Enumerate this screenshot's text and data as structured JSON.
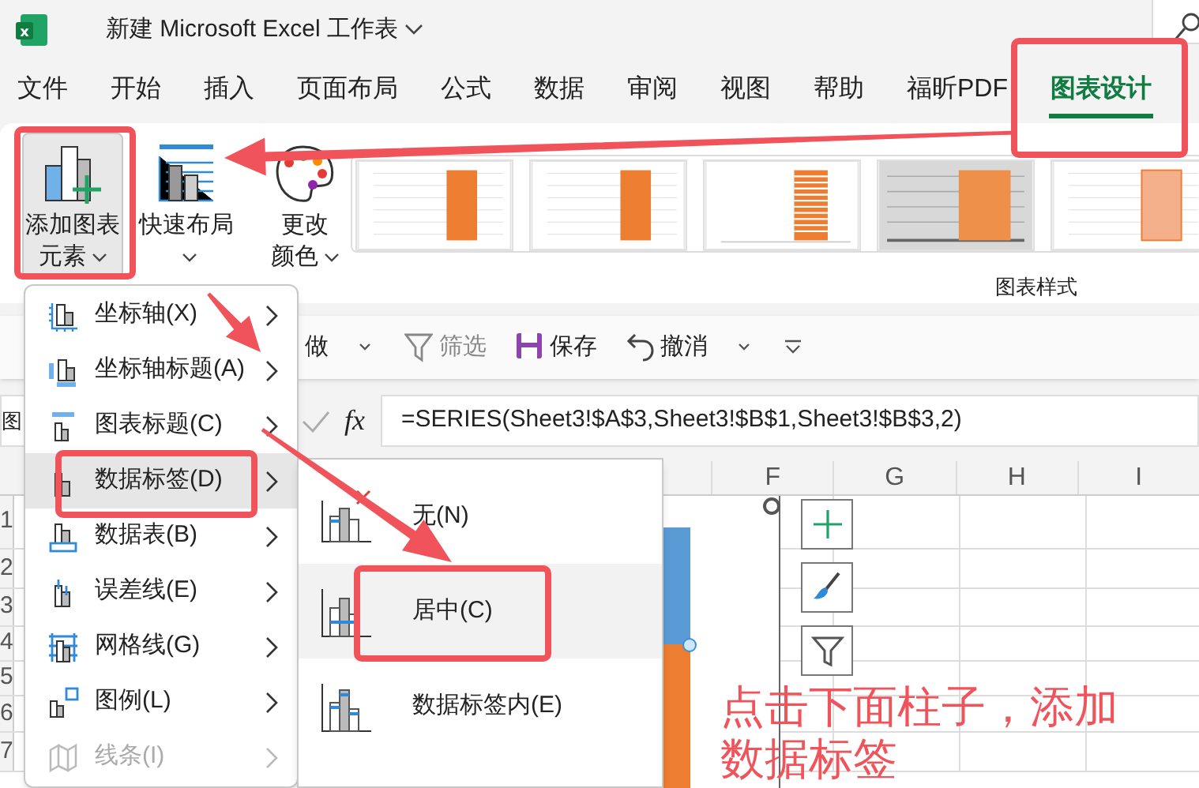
{
  "window": {
    "title": "新建 Microsoft Excel 工作表",
    "icon_letter": "x"
  },
  "ribbon_tabs": [
    {
      "label": "文件",
      "selected": false
    },
    {
      "label": "开始",
      "selected": false
    },
    {
      "label": "插入",
      "selected": false
    },
    {
      "label": "页面布局",
      "selected": false
    },
    {
      "label": "公式",
      "selected": false
    },
    {
      "label": "数据",
      "selected": false
    },
    {
      "label": "审阅",
      "selected": false
    },
    {
      "label": "视图",
      "selected": false
    },
    {
      "label": "帮助",
      "selected": false
    },
    {
      "label": "福昕PDF",
      "selected": false
    },
    {
      "label": "图表设计",
      "selected": true
    }
  ],
  "ribbon": {
    "buttons": [
      {
        "kind": "add_element",
        "label": "添加图表元素",
        "expanded": true
      },
      {
        "kind": "quick_layout",
        "label": "快速布局",
        "expanded": false
      },
      {
        "kind": "colors",
        "label": "更改颜色",
        "expanded": false
      }
    ],
    "gallery_label": "图表样式"
  },
  "quick_access": [
    {
      "kind": "redo",
      "label": "做"
    },
    {
      "kind": "filter",
      "label": "筛选"
    },
    {
      "kind": "save",
      "label": "保存"
    },
    {
      "kind": "undo",
      "label": "撤消"
    }
  ],
  "formula_bar": {
    "name_box": "图",
    "function_label": "fx",
    "formula": "=SERIES(Sheet3!$A$3,Sheet3!$B$1,Sheet3!$B$3,2)"
  },
  "sheet": {
    "columns": [
      "F",
      "G",
      "H",
      "I"
    ],
    "rows": [
      "1",
      "2",
      "3",
      "4",
      "5",
      "6",
      "7"
    ]
  },
  "menu": {
    "items": [
      {
        "kind": "axes",
        "label": "坐标轴(X)",
        "selected": false,
        "disabled": false
      },
      {
        "kind": "axis_titles",
        "label": "坐标轴标题(A)",
        "selected": false,
        "disabled": false
      },
      {
        "kind": "chart_title",
        "label": "图表标题(C)",
        "selected": false,
        "disabled": false
      },
      {
        "kind": "data_labels",
        "label": "数据标签(D)",
        "selected": true,
        "disabled": false
      },
      {
        "kind": "data_table",
        "label": "数据表(B)",
        "selected": false,
        "disabled": false
      },
      {
        "kind": "error_bars",
        "label": "误差线(E)",
        "selected": false,
        "disabled": false
      },
      {
        "kind": "gridlines",
        "label": "网格线(G)",
        "selected": false,
        "disabled": false
      },
      {
        "kind": "legend",
        "label": "图例(L)",
        "selected": false,
        "disabled": false
      },
      {
        "kind": "lines",
        "label": "线条(I)",
        "selected": false,
        "disabled": true
      }
    ]
  },
  "submenu": {
    "items": [
      {
        "kind": "none",
        "label": "无(N)",
        "selected": false
      },
      {
        "kind": "center",
        "label": "居中(C)",
        "selected": true
      },
      {
        "kind": "inside",
        "label": "数据标签内(E)",
        "selected": false
      }
    ]
  },
  "annotation": {
    "text": "点击下面柱子，添加数据标签"
  }
}
